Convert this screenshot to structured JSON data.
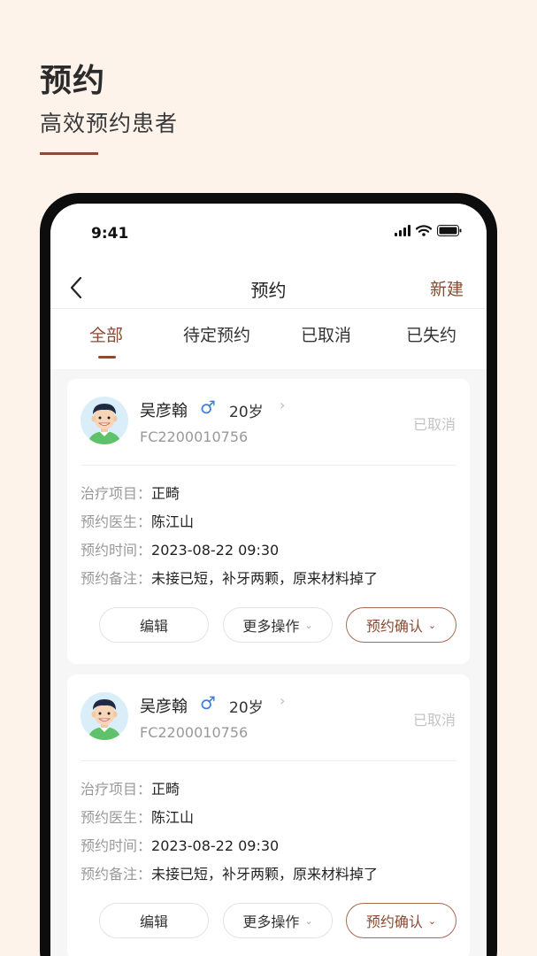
{
  "promo": {
    "title": "预约",
    "subtitle": "高效预约患者"
  },
  "status_bar": {
    "time": "9:41"
  },
  "nav": {
    "title": "预约",
    "new_label": "新建"
  },
  "tabs": [
    {
      "label": "全部",
      "active": true
    },
    {
      "label": "待定预约"
    },
    {
      "label": "已取消"
    },
    {
      "label": "已失约"
    }
  ],
  "cards": [
    {
      "name": "吴彦翰",
      "gender": "♂",
      "age": "20岁",
      "chevron": "›",
      "id": "FC2200010756",
      "status": "已取消",
      "fields": [
        {
          "label": "治疗项目：",
          "value": "正畸"
        },
        {
          "label": "预约医生：",
          "value": "陈江山"
        },
        {
          "label": "预约时间：",
          "value": "2023-08-22 09:30"
        },
        {
          "label": "预约备注：",
          "value": "未接已短，补牙两颗，原来材料掉了"
        }
      ],
      "buttons": {
        "edit": "编辑",
        "more": "更多操作",
        "confirm": "预约确认"
      }
    },
    {
      "name": "吴彦翰",
      "gender": "♂",
      "age": "20岁",
      "chevron": "›",
      "id": "FC2200010756",
      "status": "已取消",
      "fields": [
        {
          "label": "治疗项目：",
          "value": "正畸"
        },
        {
          "label": "预约医生：",
          "value": "陈江山"
        },
        {
          "label": "预约时间：",
          "value": "2023-08-22 09:30"
        },
        {
          "label": "预约备注：",
          "value": "未接已短，补牙两颗，原来材料掉了"
        }
      ],
      "buttons": {
        "edit": "编辑",
        "more": "更多操作",
        "confirm": "预约确认"
      }
    }
  ],
  "icons": {
    "chevron_down": "⌄"
  },
  "colors": {
    "accent": "#8b4a33",
    "background": "#fdf3ea",
    "male": "#3b7de0"
  }
}
